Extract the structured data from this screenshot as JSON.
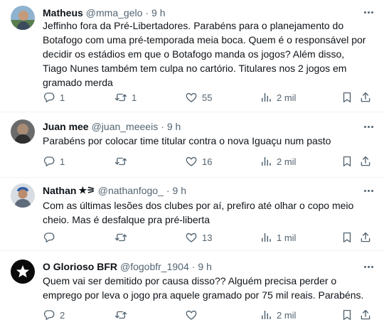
{
  "tweets": [
    {
      "name": "Matheus",
      "badge": "",
      "handle": "@mma_gelo",
      "separator": "·",
      "time": "9 h",
      "text": "Jeffinho fora da Pré-Libertadores. Parabéns para o planejamento do Botafogo com uma pré-temporada meia boca. Quem é o responsável por decidir os estádios em que o Botafogo manda os jogos? Além disso, Tiago Nunes também tem culpa no cartório. Titulares nos 2 jogos em gramado merda",
      "replies": "1",
      "retweets": "1",
      "likes": "55",
      "views": "2 mil"
    },
    {
      "name": "Juan mee",
      "badge": "",
      "handle": "@juan_meeeis",
      "separator": "·",
      "time": "9 h",
      "text": "Parabéns por colocar time titular contra o nova Iguaçu num pasto",
      "replies": "1",
      "retweets": "",
      "likes": "16",
      "views": "2 mil"
    },
    {
      "name": "Nathan",
      "badge": "★⚞",
      "handle": "@nathanfogo_",
      "separator": "·",
      "time": "9 h",
      "text": "Com as últimas lesões dos clubes por aí, prefiro até olhar o copo meio cheio. Mas é desfalque pra pré-liberta",
      "replies": "",
      "retweets": "",
      "likes": "13",
      "views": "1 mil"
    },
    {
      "name": "O Glorioso BFR",
      "badge": "",
      "handle": "@fogobfr_1904",
      "separator": "·",
      "time": "9 h",
      "text": "Quem vai ser demitido por causa disso?? Alguém precisa perder o emprego por leva o jogo pra aquele gramado por 75 mil reais. Parabéns.",
      "replies": "2",
      "retweets": "",
      "likes": "",
      "views": "2 mil"
    }
  ],
  "colors": {
    "text": "#0f1419",
    "secondary": "#536471",
    "divider": "#eff3f4"
  },
  "icons": [
    "reply-icon",
    "retweet-icon",
    "like-icon",
    "views-icon",
    "bookmark-icon",
    "share-icon",
    "more-icon"
  ]
}
